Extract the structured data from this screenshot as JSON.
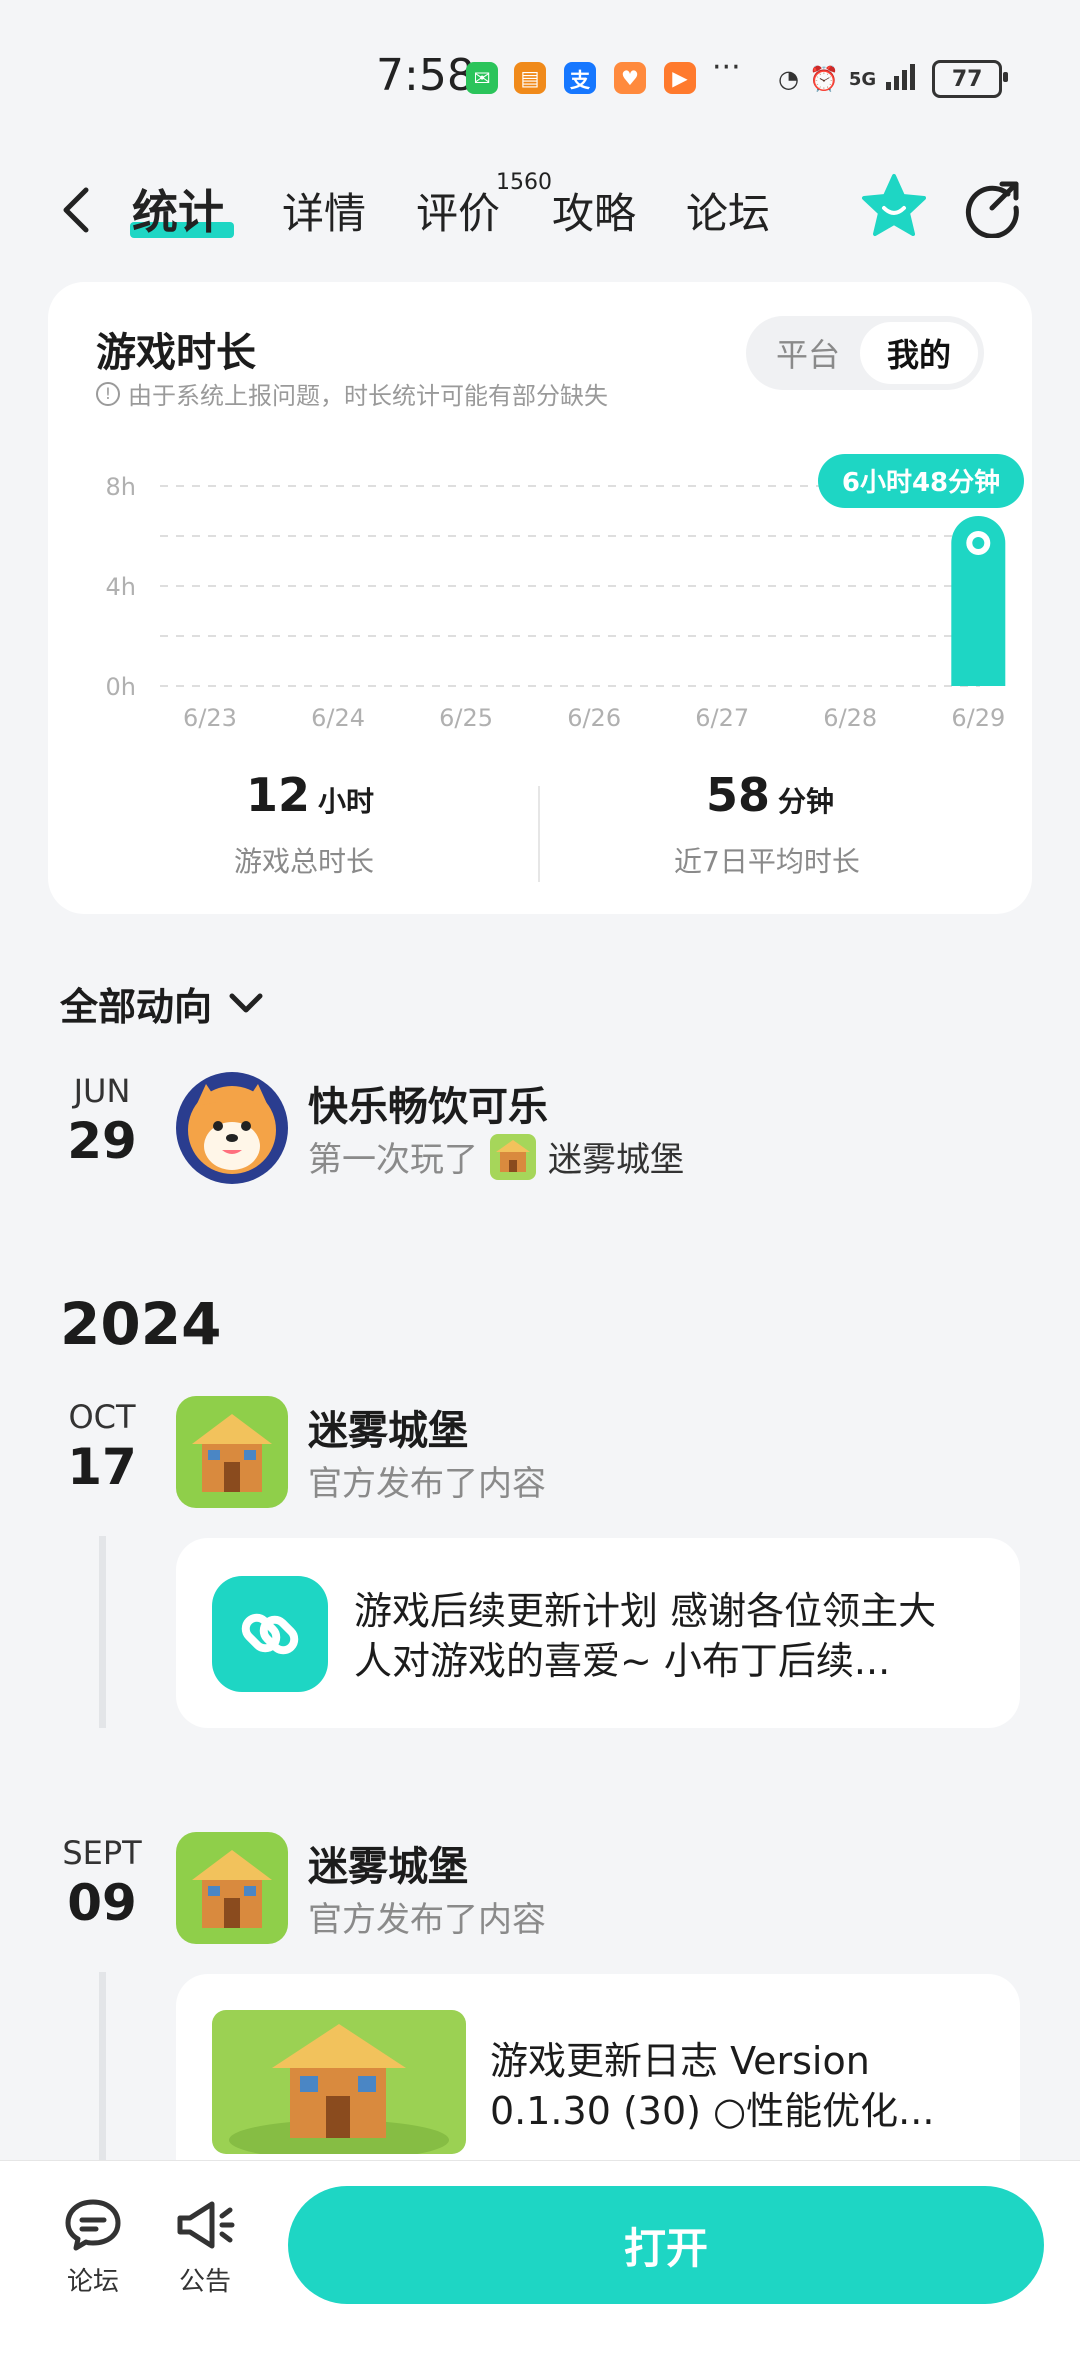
{
  "status_bar": {
    "time": "7:58",
    "dots": "···",
    "network": "5G",
    "battery": "77"
  },
  "nav": {
    "tabs": [
      {
        "label": "统计"
      },
      {
        "label": "详情"
      },
      {
        "label": "评价"
      },
      {
        "label": "攻略"
      },
      {
        "label": "论坛"
      }
    ],
    "review_count": "1560"
  },
  "playtime_card": {
    "title": "游戏时长",
    "note": "由于系统上报问题，时长统计可能有部分缺失",
    "toggle": {
      "platform": "平台",
      "mine": "我的"
    },
    "total": {
      "value": "12",
      "unit": "小时",
      "label": "游戏总时长"
    },
    "average": {
      "value": "58",
      "unit": "分钟",
      "label": "近7日平均时长"
    }
  },
  "chart_data": {
    "type": "bar",
    "categories": [
      "6/23",
      "6/24",
      "6/25",
      "6/26",
      "6/27",
      "6/28",
      "6/29"
    ],
    "values": [
      0,
      0,
      0,
      0,
      0,
      0,
      6.8
    ],
    "yticks": [
      "8h",
      "4h",
      "0h"
    ],
    "ylim": [
      0,
      8
    ],
    "highlight_label": "6小时48分钟",
    "accent_color": "#1ed6c4",
    "grid": true
  },
  "feed": {
    "filter_label": "全部动向",
    "entries": [
      {
        "month": "JUN",
        "day": "29",
        "name": "快乐畅饮可乐",
        "action": "第一次玩了",
        "game": "迷雾城堡"
      },
      {
        "month": "OCT",
        "day": "17",
        "name": "迷雾城堡",
        "action": "官方发布了内容",
        "post": "游戏后续更新计划 感谢各位领主大人对游戏的喜爱~ 小布丁后续..."
      },
      {
        "month": "SEPT",
        "day": "09",
        "name": "迷雾城堡",
        "action": "官方发布了内容",
        "post": "游戏更新日志 Version 0.1.30 (30) ○性能优化..."
      }
    ],
    "year": "2024"
  },
  "bottom_bar": {
    "forum": "论坛",
    "announce": "公告",
    "open": "打开"
  }
}
